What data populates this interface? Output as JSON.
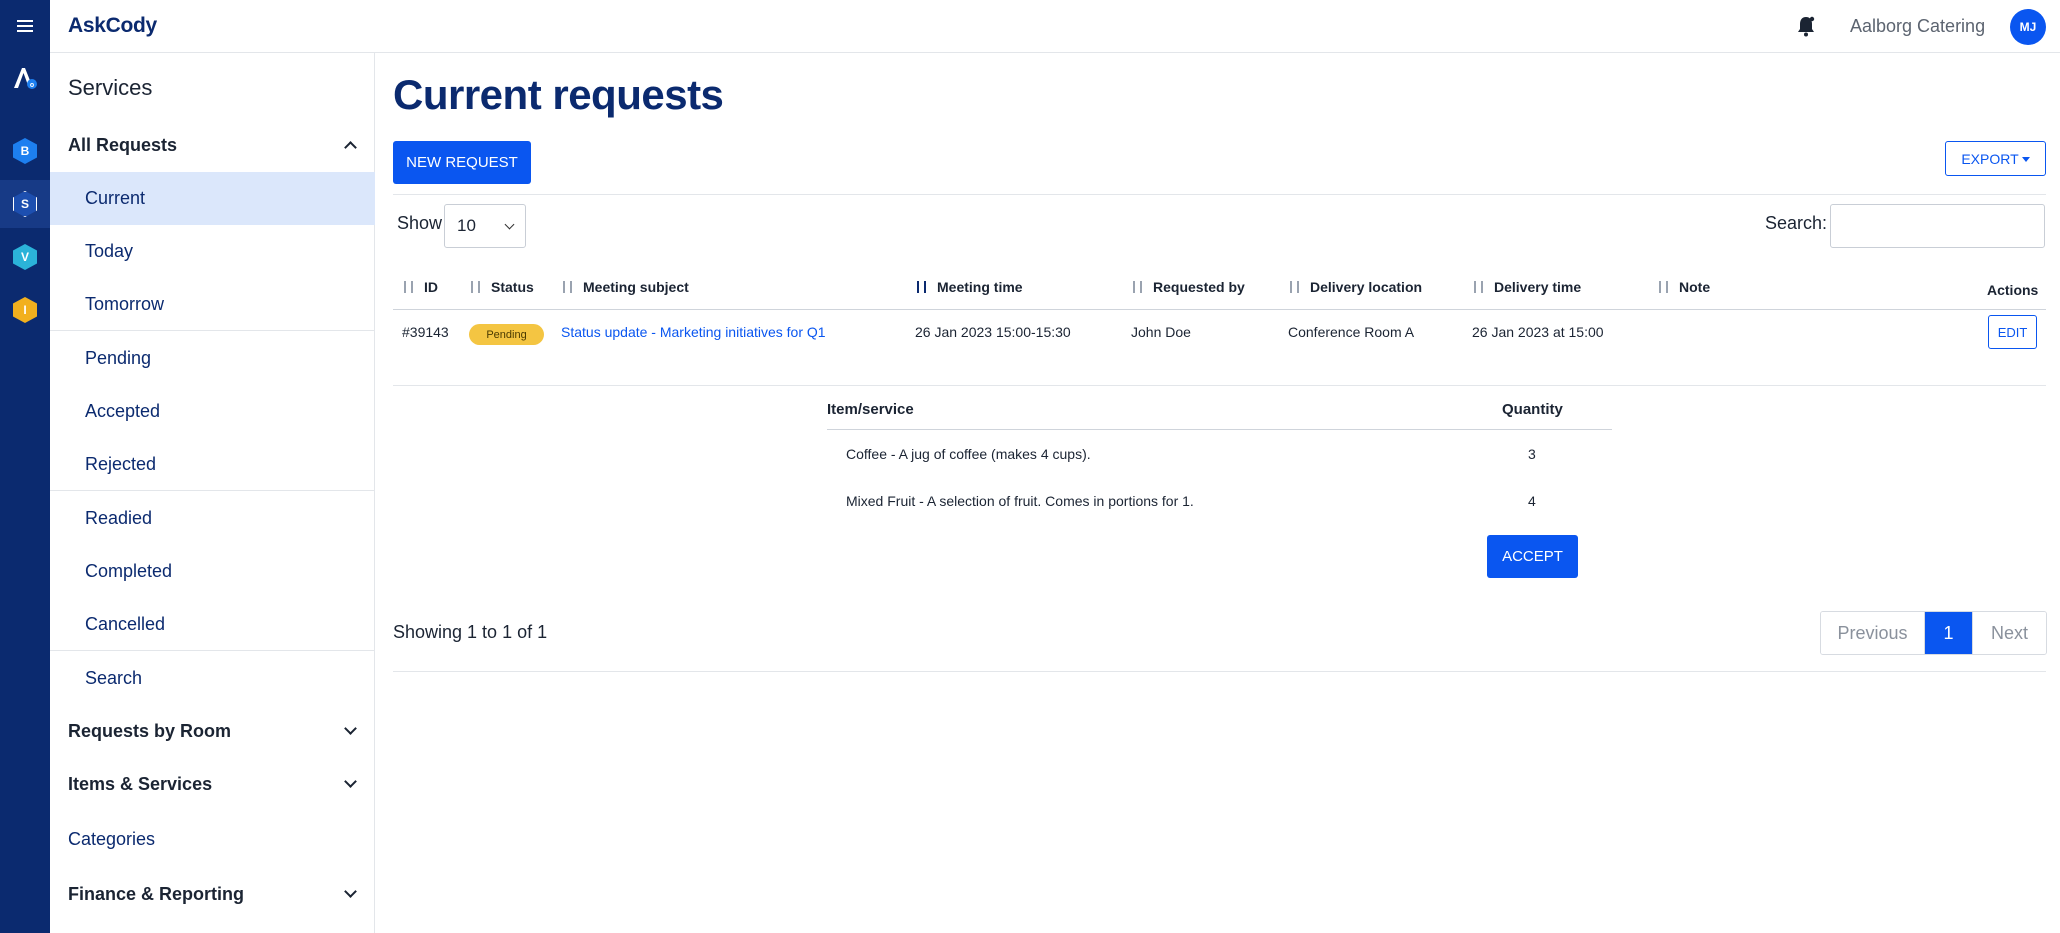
{
  "app": {
    "logo": "AskCody",
    "org": "Aalborg Catering",
    "avatar_initials": "MJ"
  },
  "rail": [
    {
      "letter": "B",
      "color": "#1d7ff0"
    },
    {
      "letter": "S",
      "color": "#1d4fb0"
    },
    {
      "letter": "V",
      "color": "#2bb3d9"
    },
    {
      "letter": "I",
      "color": "#f2b01e"
    }
  ],
  "sidebar": {
    "title": "Services",
    "all_requests": "All Requests",
    "items": [
      {
        "label": "Current"
      },
      {
        "label": "Today"
      },
      {
        "label": "Tomorrow"
      },
      {
        "label": "Pending"
      },
      {
        "label": "Accepted"
      },
      {
        "label": "Rejected"
      },
      {
        "label": "Readied"
      },
      {
        "label": "Completed"
      },
      {
        "label": "Cancelled"
      },
      {
        "label": "Search"
      }
    ],
    "requests_by_room": "Requests by Room",
    "items_services": "Items & Services",
    "categories": "Categories",
    "finance": "Finance & Reporting"
  },
  "main": {
    "title": "Current requests",
    "new_request": "NEW REQUEST",
    "export": "EXPORT",
    "show_label": "Show",
    "show_value": "10",
    "search_label": "Search:",
    "search_value": ""
  },
  "table": {
    "headers": {
      "id": "ID",
      "status": "Status",
      "subject": "Meeting subject",
      "time": "Meeting time",
      "requested_by": "Requested by",
      "location": "Delivery location",
      "delivery_time": "Delivery time",
      "note": "Note",
      "actions": "Actions"
    },
    "row": {
      "id": "#39143",
      "status": "Pending",
      "subject": "Status update - Marketing initiatives for Q1",
      "time": "26 Jan 2023 15:00-15:30",
      "requested_by": "John Doe",
      "location": "Conference Room A",
      "delivery_time": "26 Jan 2023 at 15:00",
      "note": "",
      "edit": "EDIT"
    }
  },
  "items": {
    "header_item": "Item/service",
    "header_qty": "Quantity",
    "rows": [
      {
        "name": "Coffee - A jug of coffee (makes 4 cups).",
        "qty": "3"
      },
      {
        "name": "Mixed Fruit - A selection of fruit. Comes in portions for 1.",
        "qty": "4"
      }
    ],
    "accept": "ACCEPT"
  },
  "footer": {
    "showing": "Showing 1 to 1 of 1",
    "previous": "Previous",
    "page": "1",
    "next": "Next"
  }
}
